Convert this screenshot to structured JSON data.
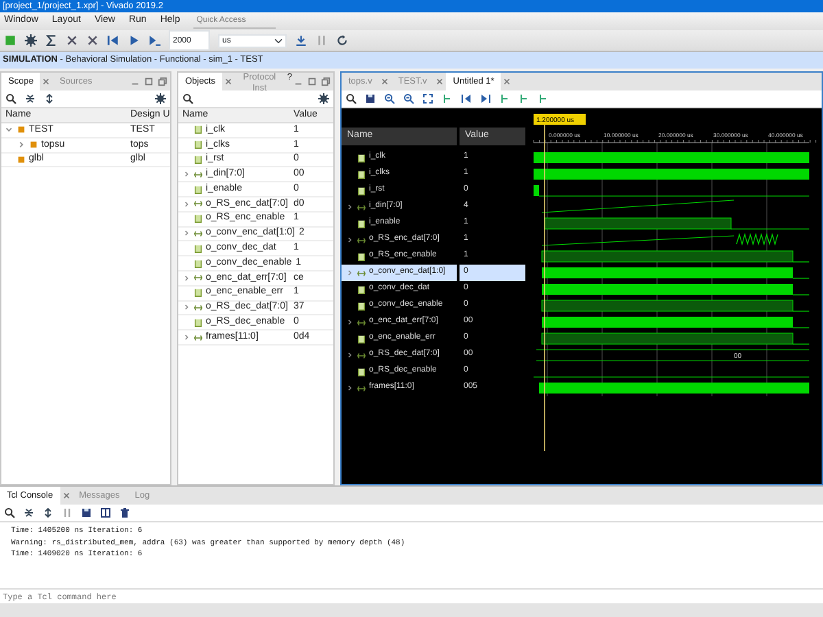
{
  "window": {
    "title": "[project_1/project_1.xpr] - Vivado 2019.2"
  },
  "menu": [
    "Window",
    "Layout",
    "View",
    "Run",
    "Help"
  ],
  "quick_access": {
    "placeholder": "Quick Access"
  },
  "toolbar": {
    "run_time": "2000",
    "run_unit": "us"
  },
  "sim_bar": {
    "mode": "SIMULATION",
    "details": "- Behavioral Simulation - Functional - sim_1 - TEST"
  },
  "scope_panel": {
    "tabs": [
      {
        "label": "Scope",
        "selected": true
      },
      {
        "label": "Sources",
        "selected": false
      }
    ],
    "columns": [
      "Name",
      "Design U"
    ],
    "tree": [
      {
        "name": "TEST",
        "unit": "TEST",
        "expanded": true,
        "children": [
          {
            "name": "topsu",
            "unit": "tops",
            "expanded": false
          }
        ]
      },
      {
        "name": "glbl",
        "unit": "glbl"
      }
    ]
  },
  "objects_panel": {
    "tabs": [
      {
        "label": "Objects",
        "selected": true
      },
      {
        "label": "Protocol Inst",
        "selected": false
      }
    ],
    "help": "?",
    "columns": [
      "Name",
      "Value"
    ],
    "rows": [
      {
        "name": "i_clk",
        "value": "1",
        "kind": "bit"
      },
      {
        "name": "i_clks",
        "value": "1",
        "kind": "bit"
      },
      {
        "name": "i_rst",
        "value": "0",
        "kind": "bit"
      },
      {
        "name": "i_din[7:0]",
        "value": "00",
        "kind": "bus"
      },
      {
        "name": "i_enable",
        "value": "0",
        "kind": "bit"
      },
      {
        "name": "o_RS_enc_dat[7:0]",
        "value": "d0",
        "kind": "bus"
      },
      {
        "name": "o_RS_enc_enable",
        "value": "1",
        "kind": "bit"
      },
      {
        "name": "o_conv_enc_dat[1:0]",
        "value": "2",
        "kind": "bus"
      },
      {
        "name": "o_conv_dec_dat",
        "value": "1",
        "kind": "bit"
      },
      {
        "name": "o_conv_dec_enable",
        "value": "1",
        "kind": "bit"
      },
      {
        "name": "o_enc_dat_err[7:0]",
        "value": "ce",
        "kind": "bus"
      },
      {
        "name": "o_enc_enable_err",
        "value": "1",
        "kind": "bit"
      },
      {
        "name": "o_RS_dec_dat[7:0]",
        "value": "37",
        "kind": "bus"
      },
      {
        "name": "o_RS_dec_enable",
        "value": "0",
        "kind": "bit"
      },
      {
        "name": "frames[11:0]",
        "value": "0d4",
        "kind": "bus"
      }
    ]
  },
  "wave_panel": {
    "tabs": [
      {
        "label": "tops.v",
        "selected": false
      },
      {
        "label": "TEST.v",
        "selected": false
      },
      {
        "label": "Untitled 1*",
        "selected": true
      }
    ],
    "columns": [
      "Name",
      "Value"
    ],
    "cursor": "1.200000 us",
    "ticks": [
      "0.000000 us",
      "10.000000 us",
      "20.000000 us",
      "30.000000 us",
      "40.000000 us"
    ],
    "rows": [
      {
        "name": "i_clk",
        "value": "1",
        "kind": "bit",
        "selected": false
      },
      {
        "name": "i_clks",
        "value": "1",
        "kind": "bit",
        "selected": false
      },
      {
        "name": "i_rst",
        "value": "0",
        "kind": "bit",
        "selected": false
      },
      {
        "name": "i_din[7:0]",
        "value": "4",
        "kind": "bus",
        "selected": false
      },
      {
        "name": "i_enable",
        "value": "1",
        "kind": "bit",
        "selected": false
      },
      {
        "name": "o_RS_enc_dat[7:0]",
        "value": "1",
        "kind": "bus",
        "selected": false
      },
      {
        "name": "o_RS_enc_enable",
        "value": "1",
        "kind": "bit",
        "selected": false
      },
      {
        "name": "o_conv_enc_dat[1:0]",
        "value": "0",
        "kind": "bus",
        "selected": true
      },
      {
        "name": "o_conv_dec_dat",
        "value": "0",
        "kind": "bit",
        "selected": false
      },
      {
        "name": "o_conv_dec_enable",
        "value": "0",
        "kind": "bit",
        "selected": false
      },
      {
        "name": "o_enc_dat_err[7:0]",
        "value": "00",
        "kind": "bus",
        "selected": false
      },
      {
        "name": "o_enc_enable_err",
        "value": "0",
        "kind": "bit",
        "selected": false
      },
      {
        "name": "o_RS_dec_dat[7:0]",
        "value": "00",
        "kind": "bus",
        "selected": false,
        "wave_label": "00"
      },
      {
        "name": "o_RS_dec_enable",
        "value": "0",
        "kind": "bit",
        "selected": false
      },
      {
        "name": "frames[11:0]",
        "value": "005",
        "kind": "bus",
        "selected": false
      }
    ]
  },
  "console": {
    "tabs": [
      {
        "label": "Tcl Console",
        "selected": true
      },
      {
        "label": "Messages",
        "selected": false
      },
      {
        "label": "Log",
        "selected": false
      }
    ],
    "lines": [
      "Time: 1405200 ns  Iteration: 6",
      "Warning: rs_distributed_mem, addra (63) was greater than supported by memory depth (48)",
      "Time: 1409020 ns  Iteration: 6"
    ],
    "placeholder": "Type a Tcl command here"
  }
}
